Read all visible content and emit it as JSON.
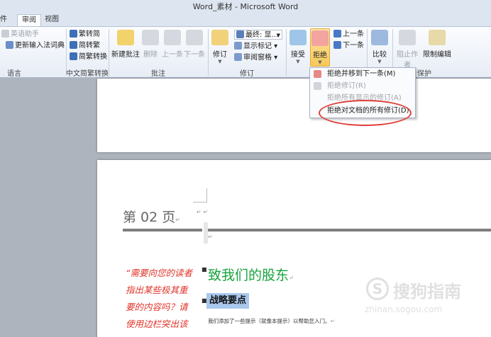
{
  "window": {
    "title": "Word_素材 - Microsoft Word"
  },
  "tabs": [
    {
      "label": "件",
      "active": false
    },
    {
      "label": "审阅",
      "active": true
    },
    {
      "label": "视图",
      "active": false
    }
  ],
  "ribbon": {
    "language": {
      "label": "语言",
      "items": [
        "英语助手",
        "更新输入法词典"
      ]
    },
    "chinese": {
      "label": "中文简繁转换",
      "items": [
        "繁转简",
        "简转繁",
        "简繁转换"
      ]
    },
    "comments": {
      "label": "批注",
      "new": "新建批注",
      "delete": "删除",
      "prev": "上一条",
      "next": "下一条"
    },
    "tracking": {
      "label": "修订",
      "track": "修订",
      "final_display": "最终: 显...",
      "show_markup": "显示标记",
      "review_pane": "审阅窗格"
    },
    "changes": {
      "accept": "接受",
      "reject": "拒绝",
      "prev": "上一条",
      "next": "下一条"
    },
    "compare": {
      "label": "比较"
    },
    "protect": {
      "label": "保护",
      "block_authors": "阻止作者",
      "restrict_editing": "限制编辑"
    }
  },
  "reject_menu": {
    "items": [
      {
        "label": "拒绝并移到下一条(M)",
        "disabled": false
      },
      {
        "label": "拒绝修订(R)",
        "disabled": true
      },
      {
        "label": "拒绝所有显示的修订(A)",
        "disabled": true
      },
      {
        "label": "拒绝对文档的所有修订(D)",
        "disabled": false
      }
    ]
  },
  "document": {
    "page_label": "第 02 页",
    "sidebar_quote": [
      "“需要向您的读者",
      "指出某些极其重",
      "要的内容吗？请",
      "使用边栏突出该"
    ],
    "heading": "致我们的股东",
    "subheading": "战略要点",
    "body": "我们添加了一些提示（就像本提示）以帮助您入门。"
  },
  "watermark": {
    "brand": "搜狗指南",
    "url": "zhinan.sogou.com"
  },
  "colors": {
    "accent_red": "#e0403a",
    "heading_green": "#15a33c",
    "quote_red": "#e0342a",
    "highlight_blue": "#a9c8ec"
  }
}
